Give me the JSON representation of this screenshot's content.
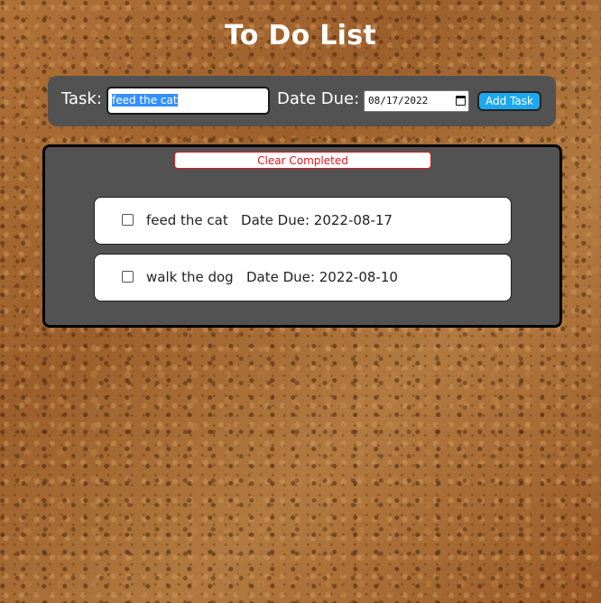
{
  "page": {
    "title": "To Do List"
  },
  "form": {
    "task_label": "Task:",
    "task_value": "feed the cat",
    "due_label": "Date Due:",
    "date_value": "08/17/2022",
    "add_label": "Add Task"
  },
  "list": {
    "clear_label": "Clear Completed",
    "tasks": [
      {
        "name": "feed the cat",
        "due": "Date Due: 2022-08-17",
        "completed": false
      },
      {
        "name": "walk the dog",
        "due": "Date Due: 2022-08-10",
        "completed": false
      }
    ]
  },
  "colors": {
    "panel": "#525252",
    "add_button": "#1ba8f0",
    "clear_button_text": "#e0161d",
    "selection": "#3390ff"
  }
}
